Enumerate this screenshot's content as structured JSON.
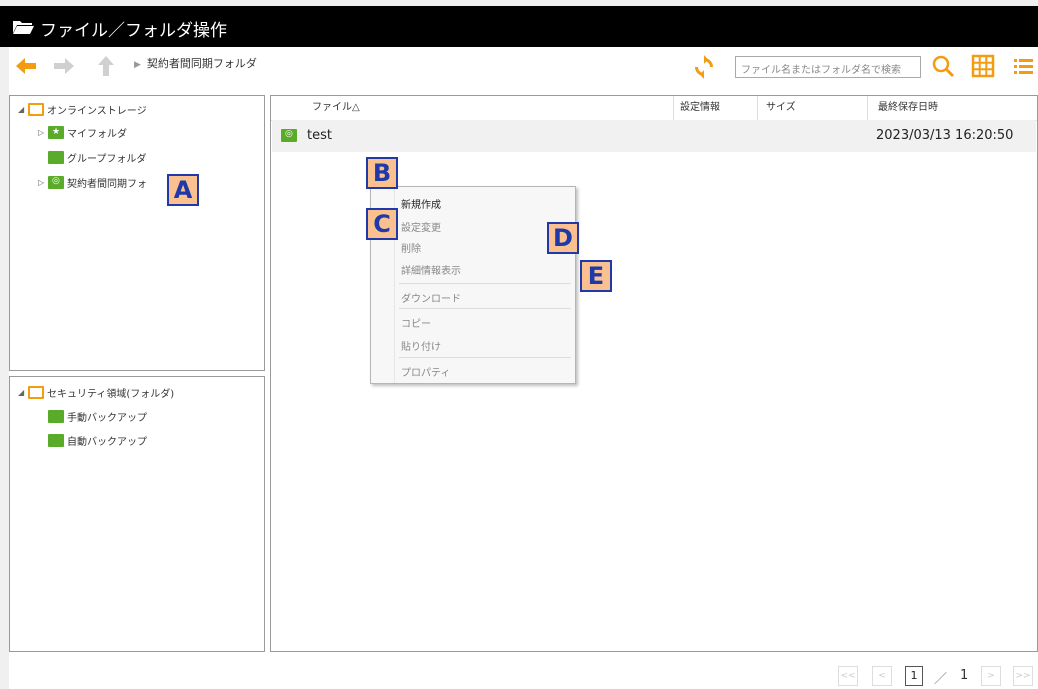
{
  "window": {
    "title": "ファイル／フォルダ操作"
  },
  "toolbar": {
    "breadcrumb": "契約者間同期フォルダ",
    "search_placeholder": "ファイル名またはフォルダ名で検索",
    "icons": [
      "back-arrow-icon",
      "forward-arrow-icon",
      "up-arrow-icon",
      "refresh-icon",
      "search-icon",
      "grid-view-icon",
      "list-view-icon"
    ]
  },
  "tree_top": {
    "root": "オンラインストレージ",
    "items": [
      "マイフォルダ",
      "グループフォルダ",
      "契約者間同期フォ"
    ]
  },
  "tree_bottom": {
    "root": "セキュリティ領域(フォルダ)",
    "items": [
      "手動バックアップ",
      "自動バックアップ"
    ]
  },
  "file_list": {
    "columns": [
      "ファイル△",
      "設定情報",
      "サイズ",
      "最終保存日時"
    ],
    "rows": [
      {
        "name": "test",
        "settings": "",
        "size": "",
        "modified": "2023/03/13 16:20:50"
      }
    ]
  },
  "context_menu": {
    "items": [
      "新規作成",
      "設定変更",
      "削除",
      "詳細情報表示",
      "ダウンロード",
      "コピー",
      "貼り付け",
      "プロパティ"
    ]
  },
  "markers": [
    "A",
    "B",
    "C",
    "D",
    "E"
  ],
  "pager": {
    "first": "<<",
    "prev": "<",
    "current": "1",
    "separator": "／",
    "total": "1",
    "next": ">",
    "last": ">>"
  },
  "colors": {
    "accent_orange": "#f39c12",
    "folder_green": "#5aab2a",
    "marker_fill": "#fac08f",
    "marker_border": "#1f3aa8"
  }
}
